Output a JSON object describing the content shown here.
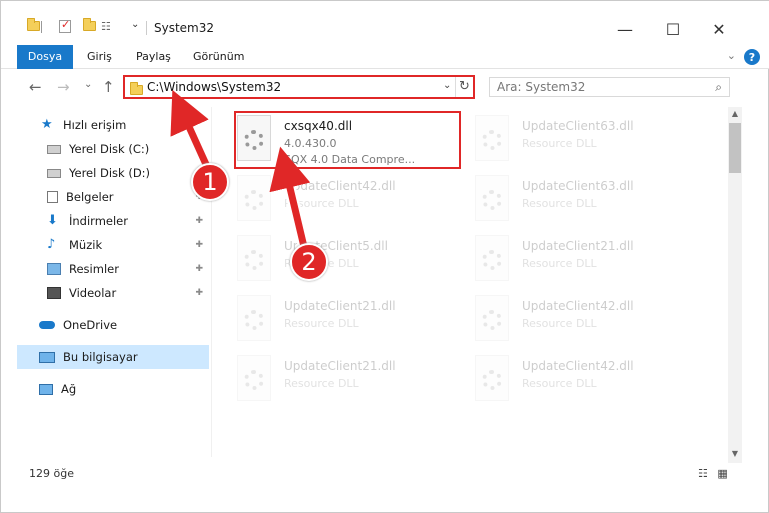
{
  "window": {
    "title": "System32",
    "minimize_glyph": "—",
    "maximize_glyph": "☐",
    "close_glyph": "✕"
  },
  "ribbon": {
    "tabs": [
      {
        "label": "Dosya",
        "active": true
      },
      {
        "label": "Giriş",
        "active": false
      },
      {
        "label": "Paylaş",
        "active": false
      },
      {
        "label": "Görünüm",
        "active": false
      }
    ],
    "help_glyph": "?",
    "collapse_glyph": "⌄"
  },
  "nav": {
    "back_glyph": "←",
    "forward_glyph": "→",
    "recent_glyph": "⌄",
    "up_glyph": "↑"
  },
  "address": {
    "path": "C:\\Windows\\System32",
    "dropdown_glyph": "⌄",
    "refresh_glyph": "↻"
  },
  "search": {
    "placeholder": "Ara: System32",
    "icon_glyph": "⌕"
  },
  "sidebar": {
    "items": [
      {
        "label": "Hızlı erişim",
        "icon": "star-icon",
        "pinned": false,
        "selected": false
      },
      {
        "label": "Yerel Disk (C:)",
        "icon": "drive-icon",
        "pinned": false,
        "selected": false
      },
      {
        "label": "Yerel Disk (D:)",
        "icon": "drive-icon",
        "pinned": false,
        "selected": false
      },
      {
        "label": "Belgeler",
        "icon": "documents-icon",
        "pinned": true,
        "selected": false
      },
      {
        "label": "İndirmeler",
        "icon": "download-icon",
        "pinned": true,
        "selected": false
      },
      {
        "label": "Müzik",
        "icon": "music-icon",
        "pinned": true,
        "selected": false
      },
      {
        "label": "Resimler",
        "icon": "pictures-icon",
        "pinned": true,
        "selected": false
      },
      {
        "label": "Videolar",
        "icon": "videos-icon",
        "pinned": true,
        "selected": false
      },
      {
        "label": "OneDrive",
        "icon": "cloud-icon",
        "pinned": false,
        "selected": false
      },
      {
        "label": "Bu bilgisayar",
        "icon": "computer-icon",
        "pinned": false,
        "selected": true
      },
      {
        "label": "Ağ",
        "icon": "network-icon",
        "pinned": false,
        "selected": false
      }
    ],
    "pin_glyph": "📌"
  },
  "files": [
    {
      "name": "cxsqx40.dll",
      "line2": "4.0.430.0",
      "line3": "SQX 4.0 Data Compre...",
      "faded": false
    },
    {
      "name": "UpdateClient63.dll",
      "line2": "Resource DLL",
      "faded": true
    },
    {
      "name": "UpdateClient42.dll",
      "line2": "Resource DLL",
      "faded": true
    },
    {
      "name": "UpdateClient63.dll",
      "line2": "Resource DLL",
      "faded": true
    },
    {
      "name": "UpdateClient5.dll",
      "line2": "Resource DLL",
      "faded": true
    },
    {
      "name": "UpdateClient21.dll",
      "line2": "Resource DLL",
      "faded": true
    },
    {
      "name": "UpdateClient21.dll",
      "line2": "Resource DLL",
      "faded": true
    },
    {
      "name": "UpdateClient42.dll",
      "line2": "Resource DLL",
      "faded": true
    },
    {
      "name": "UpdateClient21.dll",
      "line2": "Resource DLL",
      "faded": true
    },
    {
      "name": "UpdateClient42.dll",
      "line2": "Resource DLL",
      "faded": true
    }
  ],
  "status": {
    "item_count": "129 öğe",
    "details_view_glyph": "☷",
    "tiles_view_glyph": "▦"
  },
  "annotations": [
    {
      "number": "1"
    },
    {
      "number": "2"
    }
  ],
  "colors": {
    "accent": "#1979ca",
    "annotation": "#e02727",
    "selection": "#cde8ff"
  }
}
